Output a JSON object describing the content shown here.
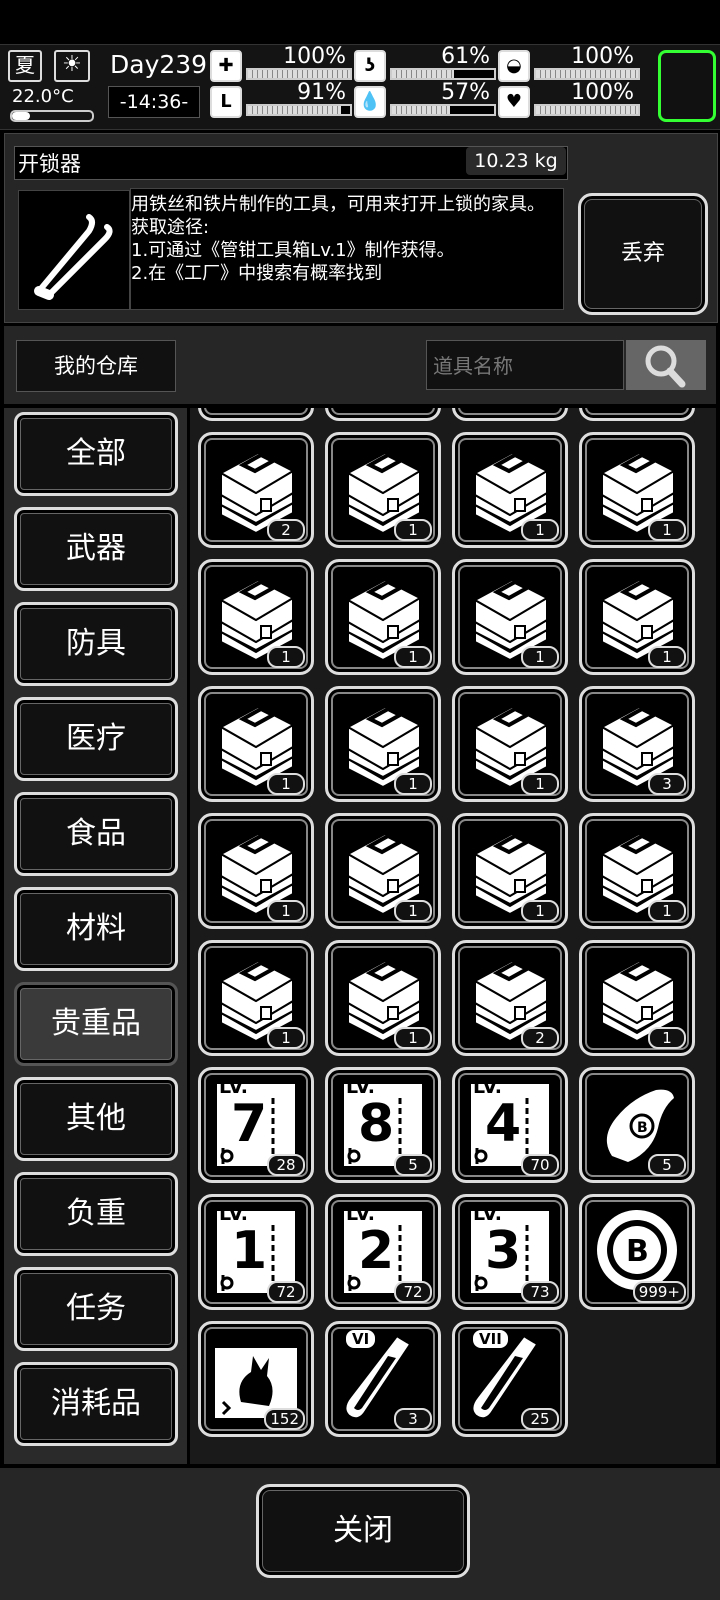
{
  "status": {
    "season": "夏",
    "temperature": "22.0°C",
    "day": "Day239",
    "time": "-14:36-",
    "stats": [
      {
        "name": "health",
        "icon": "medkit-icon",
        "value": "100%",
        "pct": 100
      },
      {
        "name": "stomach",
        "icon": "stomach-icon",
        "value": "61%",
        "pct": 61
      },
      {
        "name": "armor",
        "icon": "helmet-icon",
        "value": "100%",
        "pct": 100
      },
      {
        "name": "stamina",
        "icon": "boot-icon",
        "value": "91%",
        "pct": 91
      },
      {
        "name": "thirst",
        "icon": "water-drop-icon",
        "value": "57%",
        "pct": 57
      },
      {
        "name": "mood",
        "icon": "heart-icon",
        "value": "100%",
        "pct": 100
      }
    ]
  },
  "item": {
    "name": "开锁器",
    "weight": "10.23 kg",
    "description_lines": [
      "用铁丝和铁片制作的工具，可用来打开上锁的家具。",
      "获取途径:",
      "1.可通过《管钳工具箱Lv.1》制作获得。",
      "2.在《工厂》中搜索有概率找到"
    ],
    "discard_label": "丢弃"
  },
  "storage": {
    "title": "我的仓库",
    "search_placeholder": "道具名称"
  },
  "categories": [
    {
      "label": "全部",
      "selected": false
    },
    {
      "label": "武器",
      "selected": false
    },
    {
      "label": "防具",
      "selected": false
    },
    {
      "label": "医疗",
      "selected": false
    },
    {
      "label": "食品",
      "selected": false
    },
    {
      "label": "材料",
      "selected": false
    },
    {
      "label": "贵重品",
      "selected": true
    },
    {
      "label": "其他",
      "selected": false
    },
    {
      "label": "负重",
      "selected": false
    },
    {
      "label": "任务",
      "selected": false
    },
    {
      "label": "消耗品",
      "selected": false
    }
  ],
  "grid_items": [
    {
      "icon": "toolbox-icon",
      "count": "2"
    },
    {
      "icon": "toolbox-icon",
      "count": "1"
    },
    {
      "icon": "toolbox-icon",
      "count": "1"
    },
    {
      "icon": "toolbox-icon",
      "count": "1"
    },
    {
      "icon": "toolbox-icon",
      "count": "1"
    },
    {
      "icon": "toolbox-icon",
      "count": "1"
    },
    {
      "icon": "toolbox-icon",
      "count": "1"
    },
    {
      "icon": "toolbox-icon",
      "count": "1"
    },
    {
      "icon": "toolbox-icon",
      "count": "1"
    },
    {
      "icon": "toolbox-icon",
      "count": "1"
    },
    {
      "icon": "toolbox-icon",
      "count": "1"
    },
    {
      "icon": "toolbox-icon",
      "count": "3"
    },
    {
      "icon": "toolbox-icon",
      "count": "1"
    },
    {
      "icon": "toolbox-icon",
      "count": "1"
    },
    {
      "icon": "toolbox-icon",
      "count": "1"
    },
    {
      "icon": "toolbox-icon",
      "count": "1"
    },
    {
      "icon": "toolbox-icon",
      "count": "1"
    },
    {
      "icon": "toolbox-icon",
      "count": "1"
    },
    {
      "icon": "toolbox-icon",
      "count": "2"
    },
    {
      "icon": "toolbox-icon",
      "count": "1"
    },
    {
      "icon": "blueprint-icon",
      "level": "LV.",
      "num": "7",
      "count": "28"
    },
    {
      "icon": "blueprint-icon",
      "level": "LV.",
      "num": "8",
      "count": "5"
    },
    {
      "icon": "blueprint-icon",
      "level": "LV.",
      "num": "4",
      "count": "70"
    },
    {
      "icon": "scroll-icon",
      "count": "5"
    },
    {
      "icon": "blueprint-icon",
      "level": "LV.",
      "num": "1",
      "count": "72"
    },
    {
      "icon": "blueprint-icon",
      "level": "LV.",
      "num": "2",
      "count": "72"
    },
    {
      "icon": "blueprint-icon",
      "level": "LV.",
      "num": "3",
      "count": "73"
    },
    {
      "icon": "coin-icon",
      "coin_letter": "B",
      "count": "999+"
    },
    {
      "icon": "poster-icon",
      "count": "152"
    },
    {
      "icon": "test-tube-icon",
      "tier": "VI",
      "count": "3"
    },
    {
      "icon": "test-tube-icon",
      "tier": "VII",
      "count": "25"
    }
  ],
  "close_label": "关闭"
}
